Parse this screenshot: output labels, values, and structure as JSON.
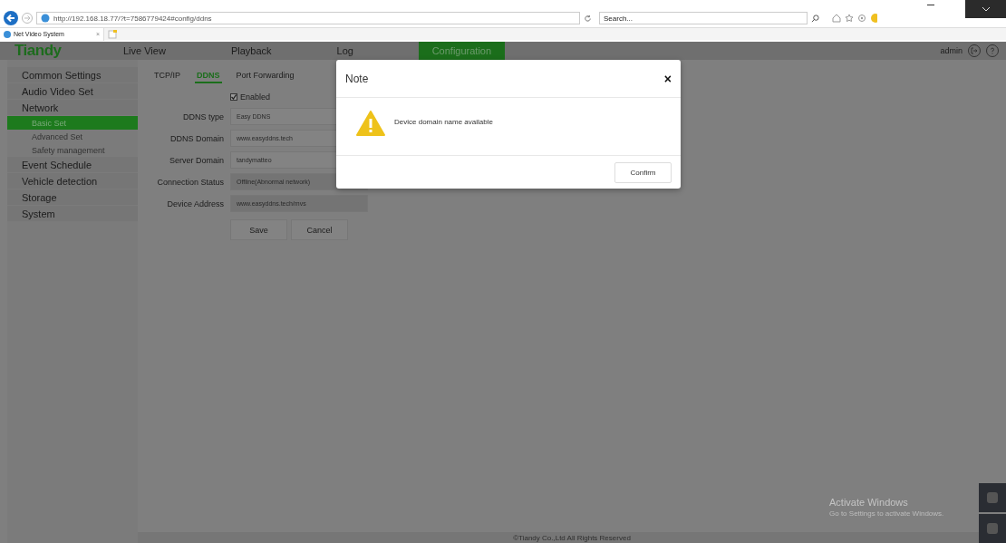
{
  "browser": {
    "address": "http://192.168.18.77/?t=7586779424#config/ddns",
    "search_placeholder": "Search...",
    "tab_title": "Net Video System",
    "tab_close": "×"
  },
  "header": {
    "logo": "Tiandy",
    "nav": [
      {
        "label": "Live View",
        "selected": false
      },
      {
        "label": "Playback",
        "selected": false
      },
      {
        "label": "Log",
        "selected": false
      },
      {
        "label": "Configuration",
        "selected": true
      }
    ],
    "user": "admin"
  },
  "sidebar": {
    "items": [
      {
        "label": "Common Settings",
        "selected": false
      },
      {
        "label": "Audio Video Set",
        "selected": false
      },
      {
        "label": "Network",
        "selected": false,
        "children": [
          {
            "label": "Basic Set",
            "selected": true
          },
          {
            "label": "Advanced Set",
            "selected": false
          },
          {
            "label": "Safety management",
            "selected": false
          }
        ]
      },
      {
        "label": "Event Schedule",
        "selected": false
      },
      {
        "label": "Vehicle detection",
        "selected": false
      },
      {
        "label": "Storage",
        "selected": false
      },
      {
        "label": "System",
        "selected": false
      }
    ]
  },
  "tabs": [
    {
      "label": "TCP/IP",
      "selected": false
    },
    {
      "label": "DDNS",
      "selected": true
    },
    {
      "label": "Port Forwarding",
      "selected": false
    }
  ],
  "form": {
    "enabled": {
      "label": "Enabled",
      "checked": true
    },
    "fields": [
      {
        "label": "DDNS type",
        "value": "Easy DDNS",
        "disabled": false
      },
      {
        "label": "DDNS Domain",
        "value": "www.easyddns.tech",
        "disabled": false
      },
      {
        "label": "Server Domain",
        "value": "tandymatteo",
        "disabled": false
      },
      {
        "label": "Connection Status",
        "value": "Offline(Abnormal network)",
        "disabled": true
      },
      {
        "label": "Device Address",
        "value": "www.easyddns.tech/mvs",
        "disabled": true
      }
    ],
    "buttons": [
      "Save",
      "Cancel"
    ]
  },
  "dialog": {
    "title": "Note",
    "close": "×",
    "message": "Device domain name available",
    "confirm": "Confirm"
  },
  "footer": "©Tiandy Co.,Ltd All Rights Reserved",
  "os_notice": {
    "title": "Activate Windows",
    "subtitle": "Go to Settings to activate Windows."
  }
}
